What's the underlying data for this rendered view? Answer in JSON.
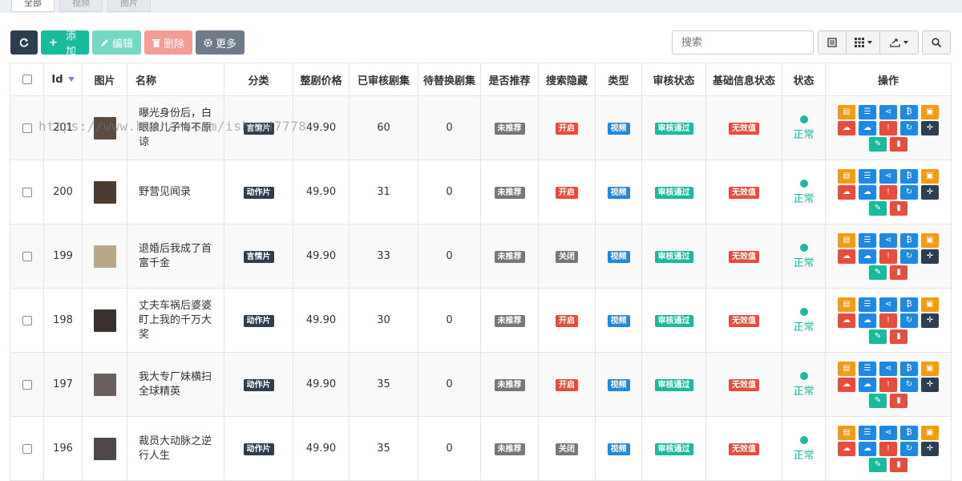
{
  "tabs": [
    "全部",
    "视频",
    "图片"
  ],
  "toolbar": {
    "add_label": "添加",
    "edit_label": "编辑",
    "delete_label": "删除",
    "more_label": "更多"
  },
  "search": {
    "placeholder": "搜索"
  },
  "table": {
    "headers": {
      "id": "Id",
      "image": "图片",
      "name": "名称",
      "category": "分类",
      "price": "整剧价格",
      "approved": "已审核剧集",
      "pending": "待替换剧集",
      "recommend": "是否推荐",
      "search_hide": "搜索隐藏",
      "type": "类型",
      "audit": "审核状态",
      "info_status": "基础信息状态",
      "status": "状态",
      "ops": "操作"
    },
    "rows": [
      {
        "id": "201",
        "name": "曝光身份后，白眼狼儿子悔不原谅",
        "category": "言情片",
        "price": "49.90",
        "approved": "60",
        "pending": "0",
        "recommend": "未推荐",
        "search_hide": "开启",
        "type": "视频",
        "audit": "审核通过",
        "info_status": "无效值",
        "status": "正常",
        "thumb_color": "#5a4a40"
      },
      {
        "id": "200",
        "name": "野营见闻录",
        "category": "动作片",
        "price": "49.90",
        "approved": "31",
        "pending": "0",
        "recommend": "未推荐",
        "search_hide": "开启",
        "type": "视频",
        "audit": "审核通过",
        "info_status": "无效值",
        "status": "正常",
        "thumb_color": "#4a3a30"
      },
      {
        "id": "199",
        "name": "退婚后我成了首富千金",
        "category": "言情片",
        "price": "49.90",
        "approved": "33",
        "pending": "0",
        "recommend": "未推荐",
        "search_hide": "关闭",
        "type": "视频",
        "audit": "审核通过",
        "info_status": "无效值",
        "status": "正常",
        "thumb_color": "#b8a888"
      },
      {
        "id": "198",
        "name": "丈夫车祸后婆婆盯上我的千万大奖",
        "category": "动作片",
        "price": "49.90",
        "approved": "30",
        "pending": "0",
        "recommend": "未推荐",
        "search_hide": "开启",
        "type": "视频",
        "audit": "审核通过",
        "info_status": "无效值",
        "status": "正常",
        "thumb_color": "#3a3030"
      },
      {
        "id": "197",
        "name": "我大专厂妹横扫全球精英",
        "category": "动作片",
        "price": "49.90",
        "approved": "35",
        "pending": "0",
        "recommend": "未推荐",
        "search_hide": "开启",
        "type": "视频",
        "audit": "审核通过",
        "info_status": "无效值",
        "status": "正常",
        "thumb_color": "#6a6060"
      },
      {
        "id": "196",
        "name": "裁员大动脉之逆行人生",
        "category": "动作片",
        "price": "49.90",
        "approved": "35",
        "pending": "0",
        "recommend": "未推荐",
        "search_hide": "关闭",
        "type": "视频",
        "audit": "审核通过",
        "info_status": "无效值",
        "status": "正常",
        "thumb_color": "#504848"
      }
    ]
  },
  "watermark": "https://www.huzhan.com/ishop47778",
  "colors": {
    "primary_dark": "#2c3e50",
    "success": "#18bc9c",
    "danger": "#e74c3c",
    "info": "#1e88e5",
    "warning": "#f39c12"
  }
}
